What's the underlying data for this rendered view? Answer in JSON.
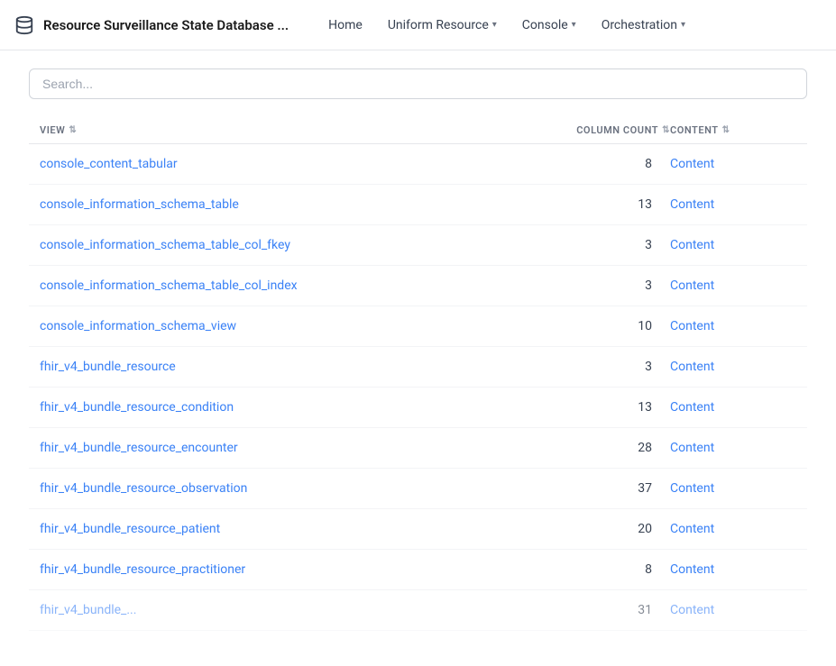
{
  "navbar": {
    "logo_icon": "database",
    "title": "Resource Surveillance State Database ...",
    "links": [
      {
        "label": "Home",
        "has_dropdown": false
      },
      {
        "label": "Uniform Resource",
        "has_dropdown": true
      },
      {
        "label": "Console",
        "has_dropdown": true
      },
      {
        "label": "Orchestration",
        "has_dropdown": true
      }
    ]
  },
  "search": {
    "placeholder": "Search..."
  },
  "table": {
    "columns": [
      {
        "label": "VIEW",
        "key": "view"
      },
      {
        "label": "COLUMN COUNT",
        "key": "column_count"
      },
      {
        "label": "CONTENT",
        "key": "content"
      }
    ],
    "rows": [
      {
        "view": "console_content_tabular",
        "column_count": 8,
        "content": "Content"
      },
      {
        "view": "console_information_schema_table",
        "column_count": 13,
        "content": "Content"
      },
      {
        "view": "console_information_schema_table_col_fkey",
        "column_count": 3,
        "content": "Content"
      },
      {
        "view": "console_information_schema_table_col_index",
        "column_count": 3,
        "content": "Content"
      },
      {
        "view": "console_information_schema_view",
        "column_count": 10,
        "content": "Content"
      },
      {
        "view": "fhir_v4_bundle_resource",
        "column_count": 3,
        "content": "Content"
      },
      {
        "view": "fhir_v4_bundle_resource_condition",
        "column_count": 13,
        "content": "Content"
      },
      {
        "view": "fhir_v4_bundle_resource_encounter",
        "column_count": 28,
        "content": "Content"
      },
      {
        "view": "fhir_v4_bundle_resource_observation",
        "column_count": 37,
        "content": "Content"
      },
      {
        "view": "fhir_v4_bundle_resource_patient",
        "column_count": 20,
        "content": "Content"
      },
      {
        "view": "fhir_v4_bundle_resource_practitioner",
        "column_count": 8,
        "content": "Content"
      }
    ]
  }
}
